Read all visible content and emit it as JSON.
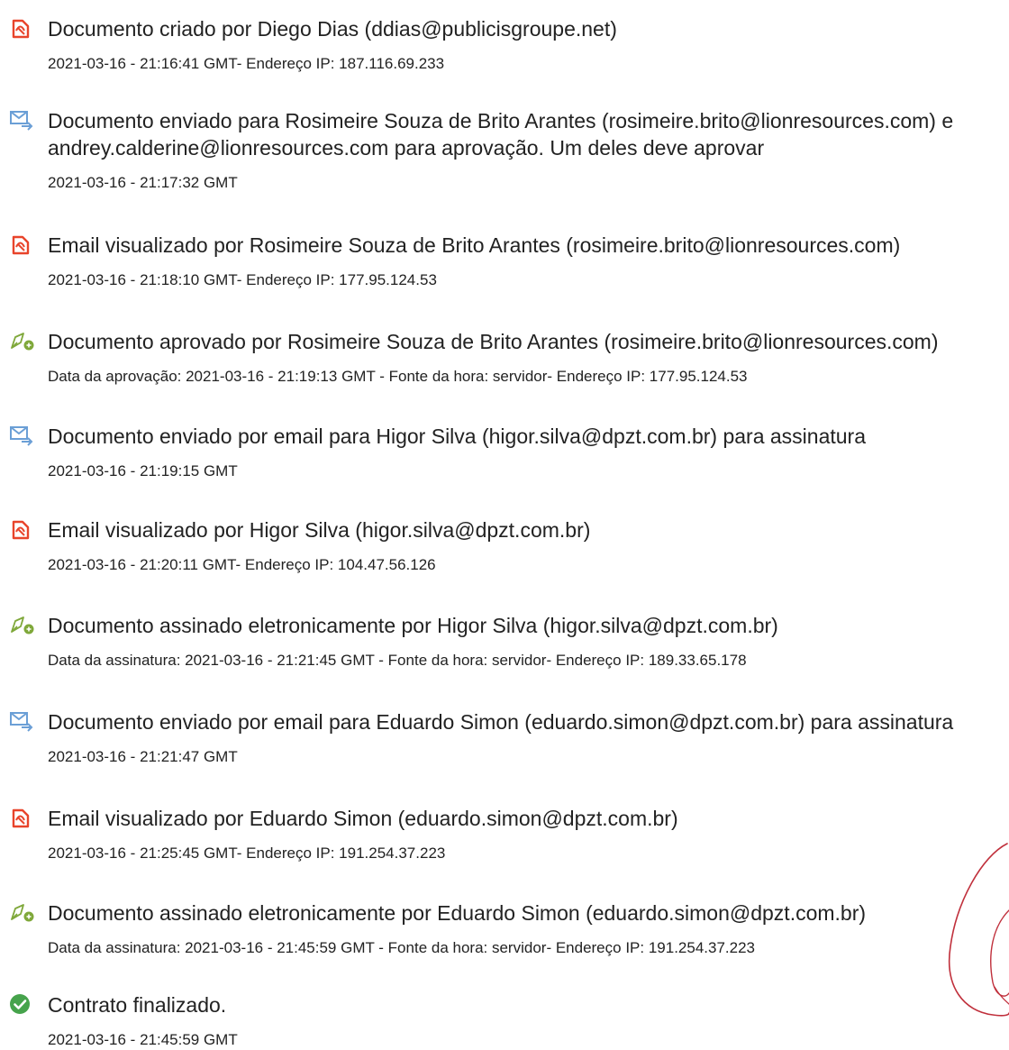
{
  "entries": [
    {
      "icon": "pdf-icon",
      "title": "Documento criado por Diego Dias (ddias@publicisgroupe.net)",
      "meta": "2021-03-16 - 21:16:41 GMT- Endereço IP: 187.116.69.233"
    },
    {
      "icon": "email-sent-icon",
      "title": "Documento enviado para Rosimeire Souza de Brito Arantes (rosimeire.brito@lionresources.com) e andrey.calderine@lionresources.com para aprovação. Um deles deve aprovar",
      "meta": "2021-03-16 - 21:17:32 GMT"
    },
    {
      "icon": "pdf-icon",
      "title": "Email visualizado por Rosimeire Souza de Brito Arantes (rosimeire.brito@lionresources.com)",
      "meta": "2021-03-16 - 21:18:10 GMT- Endereço IP: 177.95.124.53"
    },
    {
      "icon": "pen-sign-icon",
      "title": "Documento aprovado por Rosimeire Souza de Brito Arantes (rosimeire.brito@lionresources.com)",
      "meta": "Data da aprovação: 2021-03-16 - 21:19:13 GMT - Fonte da hora: servidor- Endereço IP: 177.95.124.53"
    },
    {
      "icon": "email-sent-icon",
      "title": "Documento enviado por email para Higor Silva (higor.silva@dpzt.com.br) para assinatura",
      "meta": "2021-03-16 - 21:19:15 GMT"
    },
    {
      "icon": "pdf-icon",
      "title": "Email visualizado por Higor Silva (higor.silva@dpzt.com.br)",
      "meta": "2021-03-16 - 21:20:11 GMT- Endereço IP: 104.47.56.126"
    },
    {
      "icon": "pen-sign-icon",
      "title": "Documento assinado eletronicamente por Higor Silva (higor.silva@dpzt.com.br)",
      "meta": "Data da assinatura: 2021-03-16 - 21:21:45 GMT - Fonte da hora: servidor- Endereço IP: 189.33.65.178"
    },
    {
      "icon": "email-sent-icon",
      "title": "Documento enviado por email para Eduardo Simon (eduardo.simon@dpzt.com.br) para assinatura",
      "meta": "2021-03-16 - 21:21:47 GMT"
    },
    {
      "icon": "pdf-icon",
      "title": "Email visualizado por Eduardo Simon (eduardo.simon@dpzt.com.br)",
      "meta": "2021-03-16 - 21:25:45 GMT- Endereço IP: 191.254.37.223"
    },
    {
      "icon": "pen-sign-icon",
      "title": "Documento assinado eletronicamente por Eduardo Simon (eduardo.simon@dpzt.com.br)",
      "meta": "Data da assinatura: 2021-03-16 - 21:45:59 GMT - Fonte da hora: servidor- Endereço IP: 191.254.37.223"
    },
    {
      "icon": "check-circle-icon",
      "title": "Contrato finalizado.",
      "meta": "2021-03-16 - 21:45:59 GMT"
    }
  ],
  "colors": {
    "pdf_icon": "#e8442b",
    "email_icon": "#6b9fd6",
    "pen_icon": "#7fa83a",
    "check_icon": "#46a34c",
    "signature_ink": "#c0303c"
  }
}
